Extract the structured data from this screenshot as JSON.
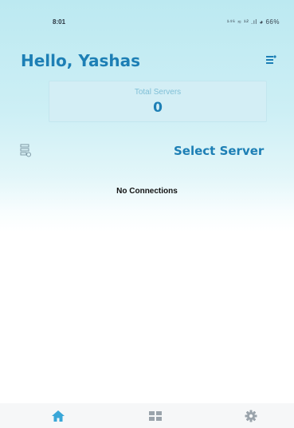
{
  "status_bar": {
    "time": "8:01",
    "indicators": "¹⁴⁶ ≈ ¹² .ıl ◕ 66%",
    "icons": [
      "wifi-icon",
      "signal-icon",
      "battery-icon"
    ]
  },
  "header": {
    "greeting": "Hello, Yashas",
    "action_icon": "server-notes-icon"
  },
  "summary": {
    "label": "Total Servers",
    "value": "0"
  },
  "servers": {
    "list_icon": "server-list-icon",
    "select_label": "Select Server",
    "empty_message": "No Connections"
  },
  "bottom_nav": {
    "items": [
      {
        "icon": "home-icon",
        "active": true
      },
      {
        "icon": "grid-icon",
        "active": false
      },
      {
        "icon": "settings-icon",
        "active": false
      }
    ]
  },
  "colors": {
    "accent": "#1d7fb5",
    "card_bg": "#d3eef5",
    "card_label": "#7fbfd6",
    "nav_active": "#3aa7d8",
    "nav_inactive": "#9aa3ab"
  }
}
